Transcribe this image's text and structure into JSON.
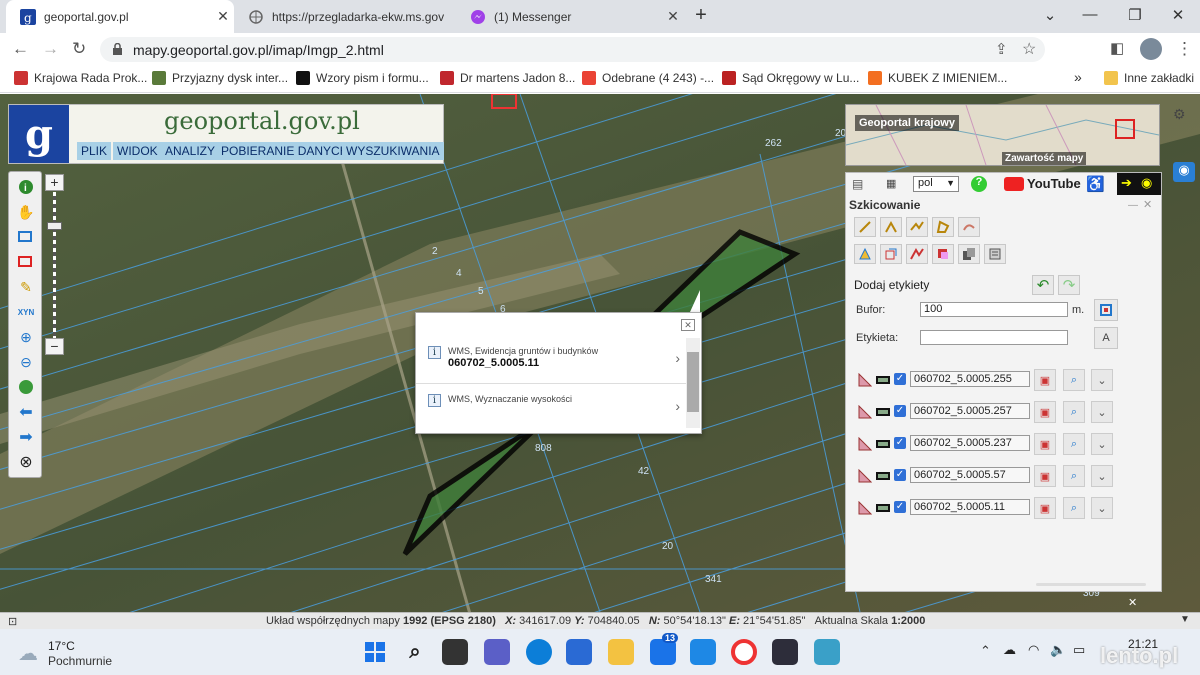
{
  "browser": {
    "tabs": [
      {
        "title": "geoportal.gov.pl",
        "active": true
      },
      {
        "title": "https://przegladarka-ekw.ms.gov",
        "active": false
      },
      {
        "title": "(1) Messenger",
        "active": false
      }
    ],
    "new_tab_symbol": "+",
    "url": "mapy.geoportal.gov.pl/imap/Imgp_2.html",
    "bookmarks": [
      "Krajowa Rada Prok...",
      "Przyjazny dysk inter...",
      "Wzory pism i formu...",
      "Dr martens Jadon 8...",
      "Odebrane (4 243) -...",
      "Sąd Okręgowy w Lu...",
      "KUBEK Z IMIENIEM..."
    ],
    "bookmarks_more": "»",
    "other_bookmarks": "Inne zakładki"
  },
  "app": {
    "logo_letter": "g",
    "site_title": "geoportal.gov.pl",
    "menu": [
      "PLIK",
      "WIDOK",
      "ANALIZY",
      "POBIERANIE DANYCH",
      "WYSZUKIWANIA"
    ],
    "zoom_in": "+",
    "zoom_out": "−",
    "xyn_label": "XYN",
    "minimap_title": "Geoportal krajowy",
    "minimap_caption": "Zawartość mapy",
    "lang": "pol",
    "youtube": "YouTube",
    "panel_title": "Szkicowanie",
    "add_labels": "Dodaj etykiety",
    "buffer_label": "Bufor:",
    "buffer_value": "100",
    "buffer_unit": "m.",
    "label_label": "Etykieta:",
    "label_value": "",
    "sketches": [
      "060702_5.0005.255",
      "060702_5.0005.257",
      "060702_5.0005.237",
      "060702_5.0005.57",
      "060702_5.0005.11"
    ],
    "map_numbers": [
      "262",
      "20",
      "2",
      "4",
      "5",
      "6",
      "808",
      "42",
      "20",
      "341",
      "309"
    ]
  },
  "popup": {
    "items": [
      {
        "layer": "WMS, Ewidencja gruntów i budynków",
        "value": "060702_5.0005.11"
      },
      {
        "layer": "WMS, Wyznaczanie wysokości",
        "value": ""
      }
    ]
  },
  "status": {
    "system_label": "Układ współrzędnych mapy",
    "system_value": "1992 (EPSG 2180)",
    "x_label": "X:",
    "x_value": "341617.09",
    "y_label": "Y:",
    "y_value": "704840.05",
    "n_label": "N:",
    "n_value": "50°54'18.13\"",
    "e_label": "E:",
    "e_value": "21°54'51.85\"",
    "scale_label": "Aktualna Skala",
    "scale_value": "1:2000"
  },
  "taskbar": {
    "temp": "17°C",
    "weather": "Pochmurnie",
    "time": "21:21",
    "mail_badge": "13",
    "watermark": "lento.pl"
  },
  "colors": {
    "parcel_fill": "#3f7f3a",
    "parcel_stroke": "#000000",
    "parcel_lines": "#4a9fe0",
    "menu_bg": "#a8d0e6",
    "checkbox": "#2f6fd6"
  }
}
